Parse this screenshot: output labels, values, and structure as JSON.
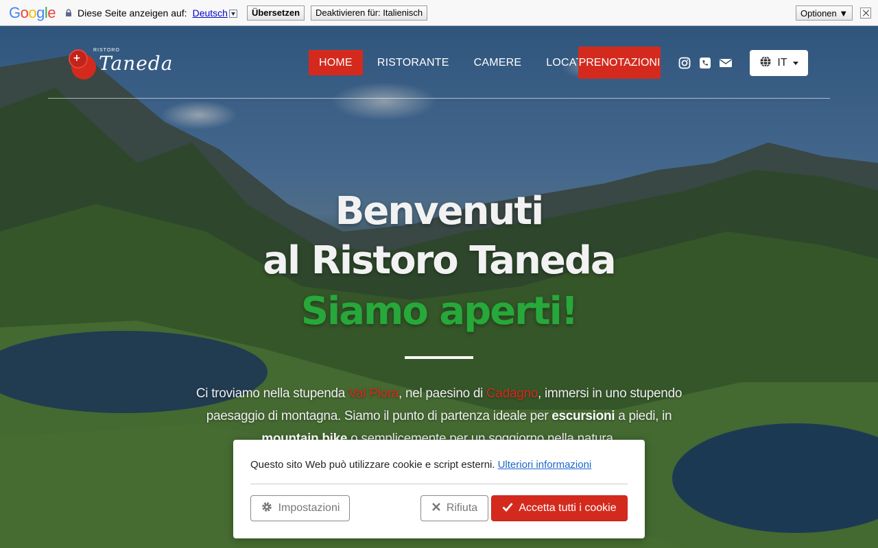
{
  "translate_bar": {
    "logo": "Google",
    "prompt": "Diese Seite anzeigen auf:",
    "language": "Deutsch",
    "translate_label": "Übersetzen",
    "deactivate_label": "Deaktivieren für: Italienisch",
    "options_label": "Optionen ▼"
  },
  "brand": {
    "small": "RISTORO",
    "script": "Taneda"
  },
  "nav": {
    "items": [
      {
        "label": "HOME"
      },
      {
        "label": "RISTORANTE"
      },
      {
        "label": "CAMERE"
      },
      {
        "label": "LOCATION"
      }
    ],
    "booking_label": "PRENOTAZIONI",
    "language_label": "IT"
  },
  "hero": {
    "title_line1": "Benvenuti",
    "title_line2": "al Ristoro Taneda",
    "status": "Siamo aperti!",
    "intro": {
      "p1": "Ci troviamo nella stupenda ",
      "place1": "Val Piora",
      "p2": ", nel paesino di ",
      "place2": "Cadagno",
      "p3": ", immersi in uno stupendo paesaggio di montagna. Siamo il punto di partenza ideale per ",
      "b1": "escursioni",
      "p4": " a piedi, in ",
      "b2": "mountain bike",
      "p5": " o semplicemente per un soggiorno nella natura."
    }
  },
  "cookie": {
    "text": "Questo sito Web può utilizzare cookie e script esterni.",
    "link": "Ulteriori informazioni",
    "settings_label": "Impostazioni",
    "reject_label": "Rifiuta",
    "accept_label": "Accetta tutti i cookie"
  },
  "colors": {
    "accent": "#d42a1e",
    "open_green": "#27a83a",
    "link_blue": "#1a66cc"
  },
  "icons": [
    "lock-icon",
    "instagram-icon",
    "phone-icon",
    "mail-icon",
    "globe-icon",
    "gear-icon",
    "close-icon",
    "check-icon"
  ]
}
